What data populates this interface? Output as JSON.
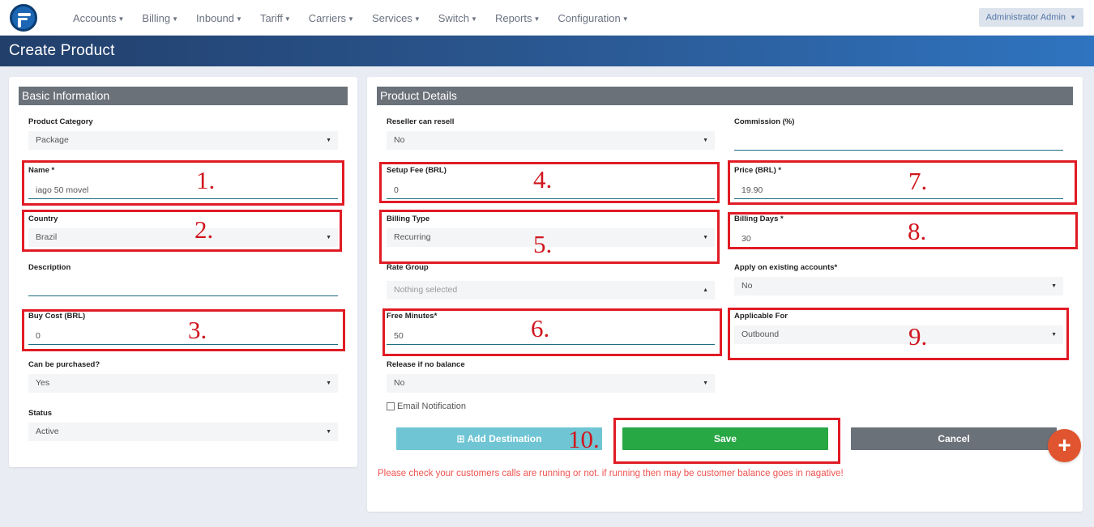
{
  "nav": {
    "menu": [
      "Accounts",
      "Billing",
      "Inbound",
      "Tariff",
      "Carriers",
      "Services",
      "Switch",
      "Reports",
      "Configuration"
    ],
    "user": "Administrator Admin"
  },
  "page": {
    "title": "Create Product"
  },
  "basic": {
    "heading": "Basic Information",
    "product_category": {
      "label": "Product Category",
      "value": "Package"
    },
    "name": {
      "label": "Name *",
      "value": "iago 50 movel"
    },
    "country": {
      "label": "Country",
      "value": "Brazil"
    },
    "description": {
      "label": "Description",
      "value": ""
    },
    "buy_cost": {
      "label": "Buy Cost (BRL)",
      "value": "0"
    },
    "can_purchase": {
      "label": "Can be purchased?",
      "value": "Yes"
    },
    "status": {
      "label": "Status",
      "value": "Active"
    }
  },
  "details": {
    "heading": "Product Details",
    "reseller": {
      "label": "Reseller can resell",
      "value": "No"
    },
    "commission": {
      "label": "Commission (%)",
      "value": ""
    },
    "setup_fee": {
      "label": "Setup Fee (BRL)",
      "value": "0"
    },
    "price": {
      "label": "Price (BRL) *",
      "value": "19.90"
    },
    "billing_type": {
      "label": "Billing Type",
      "value": "Recurring"
    },
    "billing_days": {
      "label": "Billing Days *",
      "value": "30"
    },
    "rate_group": {
      "label": "Rate Group",
      "value": "Nothing selected"
    },
    "apply_existing": {
      "label": "Apply on existing accounts*",
      "value": "No"
    },
    "free_minutes": {
      "label": "Free Minutes*",
      "value": "50"
    },
    "applicable_for": {
      "label": "Applicable For",
      "value": "Outbound"
    },
    "release": {
      "label": "Release if no balance",
      "value": "No"
    },
    "email_notification": "Email Notification"
  },
  "buttons": {
    "add_destination": "⊞ Add Destination",
    "save": "Save",
    "cancel": "Cancel",
    "fab": "+"
  },
  "warning": "Please check your customers calls are running or not. if running then may be customer balance goes in nagative!",
  "annotations": [
    "1.",
    "2.",
    "3.",
    "4.",
    "5.",
    "6.",
    "7.",
    "8.",
    "9.",
    "10."
  ],
  "colors": {
    "annotation_red": "#e01b24",
    "save_green": "#28a745",
    "add_cyan": "#6fc5d4",
    "cancel_gray": "#6b7179",
    "fab_orange": "#e0552f"
  }
}
